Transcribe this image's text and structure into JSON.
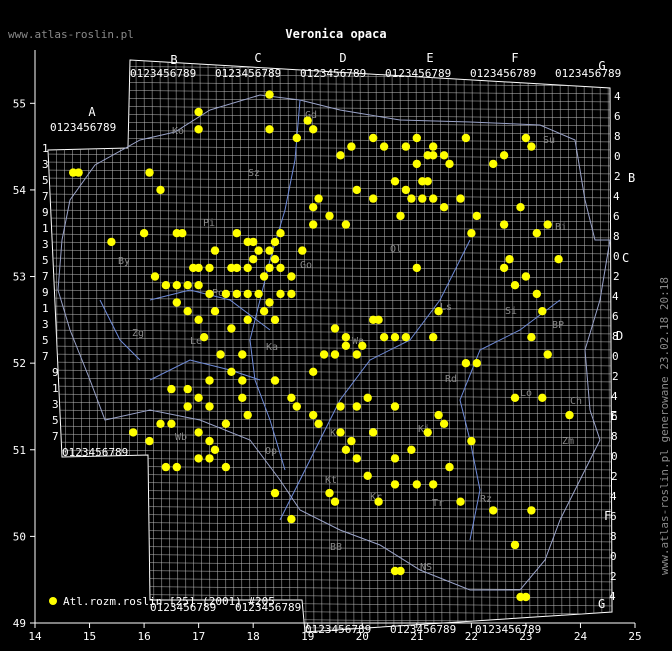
{
  "header": {
    "site": "www.atlas-roslin.pl",
    "title": "Veronica opaca"
  },
  "footer": {
    "side_text": "www.atlas-roslin.pl generowane 23.02.18 20:18"
  },
  "legend": {
    "label": "Atl.rozm.roslin [25] (2001) #205",
    "dot_color": "#ffff00"
  },
  "axes": {
    "x_ticks": [
      "14",
      "15",
      "16",
      "17",
      "18",
      "19",
      "20",
      "21",
      "22",
      "23",
      "24",
      "25"
    ],
    "y_ticks": [
      "55",
      "54",
      "53",
      "52",
      "51",
      "50",
      "49"
    ],
    "lon_range": [
      14,
      25
    ],
    "lat_range": [
      49,
      55.5
    ]
  },
  "grid": {
    "columns": [
      "A",
      "B",
      "C",
      "D",
      "E",
      "F",
      "G"
    ],
    "top_digits": "0123456789",
    "bottom_digits": "0123456789",
    "rows": [
      "A",
      "B",
      "C",
      "D",
      "E",
      "F",
      "G"
    ],
    "right_digits": [
      "0",
      "2",
      "4",
      "6",
      "8"
    ]
  },
  "regions": [
    "Ko",
    "Gd",
    "Sz",
    "Ol",
    "Su",
    "Bi",
    "Pi",
    "By",
    "Go",
    "Zg",
    "Le",
    "Po",
    "Ka",
    "Wa",
    "Si",
    "BP",
    "Lo",
    "Ch",
    "Zm",
    "Rd",
    "Kr",
    "Ki",
    "Tr",
    "Rz",
    "NS",
    "Kr",
    "Wb",
    "Op",
    "Kt",
    "BB",
    "Ls"
  ],
  "colors": {
    "background": "#000000",
    "grid": "#d8d8d8",
    "dot": "#ffff00",
    "rivers": "#6f8bd8",
    "border": "#9aa3c8",
    "axis": "#ffffff",
    "label_gray": "#8a8a8a"
  },
  "map_data": {
    "type": "distribution-map",
    "points": [
      [
        14.7,
        54.2
      ],
      [
        14.8,
        54.2
      ],
      [
        15.4,
        53.4
      ],
      [
        16.1,
        54.2
      ],
      [
        16.3,
        54.0
      ],
      [
        17.0,
        54.9
      ],
      [
        17.0,
        54.7
      ],
      [
        18.3,
        55.1
      ],
      [
        18.3,
        54.7
      ],
      [
        18.8,
        54.6
      ],
      [
        19.0,
        54.8
      ],
      [
        19.1,
        54.7
      ],
      [
        19.6,
        54.4
      ],
      [
        19.8,
        54.5
      ],
      [
        20.2,
        54.6
      ],
      [
        20.4,
        54.5
      ],
      [
        20.8,
        54.5
      ],
      [
        21.0,
        54.6
      ],
      [
        21.2,
        54.4
      ],
      [
        21.3,
        54.4
      ],
      [
        21.5,
        54.4
      ],
      [
        21.3,
        54.5
      ],
      [
        21.0,
        54.3
      ],
      [
        21.1,
        54.1
      ],
      [
        21.2,
        54.1
      ],
      [
        21.6,
        54.3
      ],
      [
        21.9,
        54.6
      ],
      [
        22.4,
        54.3
      ],
      [
        22.6,
        54.4
      ],
      [
        23.0,
        54.6
      ],
      [
        23.1,
        54.5
      ],
      [
        19.2,
        53.9
      ],
      [
        19.1,
        53.8
      ],
      [
        19.4,
        53.7
      ],
      [
        19.7,
        53.6
      ],
      [
        19.9,
        54.0
      ],
      [
        20.2,
        53.9
      ],
      [
        20.6,
        54.1
      ],
      [
        20.8,
        54.0
      ],
      [
        20.9,
        53.9
      ],
      [
        20.7,
        53.7
      ],
      [
        21.1,
        53.9
      ],
      [
        21.3,
        53.9
      ],
      [
        21.5,
        53.8
      ],
      [
        21.8,
        53.9
      ],
      [
        22.1,
        53.7
      ],
      [
        22.6,
        53.6
      ],
      [
        22.9,
        53.8
      ],
      [
        23.2,
        53.5
      ],
      [
        23.4,
        53.6
      ],
      [
        21.0,
        53.1
      ],
      [
        22.0,
        53.5
      ],
      [
        23.6,
        53.2
      ],
      [
        23.2,
        52.8
      ],
      [
        23.3,
        52.6
      ],
      [
        23.1,
        52.3
      ],
      [
        23.4,
        52.1
      ],
      [
        16.0,
        53.5
      ],
      [
        16.6,
        53.5
      ],
      [
        16.7,
        53.5
      ],
      [
        17.3,
        53.3
      ],
      [
        17.7,
        53.5
      ],
      [
        17.9,
        53.4
      ],
      [
        18.0,
        53.4
      ],
      [
        18.1,
        53.3
      ],
      [
        18.3,
        53.3
      ],
      [
        18.4,
        53.4
      ],
      [
        18.5,
        53.5
      ],
      [
        18.9,
        53.3
      ],
      [
        19.1,
        53.6
      ],
      [
        16.9,
        53.1
      ],
      [
        17.0,
        53.1
      ],
      [
        17.2,
        53.1
      ],
      [
        17.6,
        53.1
      ],
      [
        17.7,
        53.1
      ],
      [
        17.9,
        53.1
      ],
      [
        18.0,
        53.2
      ],
      [
        18.2,
        53.0
      ],
      [
        18.3,
        53.1
      ],
      [
        18.4,
        53.2
      ],
      [
        18.5,
        53.1
      ],
      [
        18.7,
        53.0
      ],
      [
        16.2,
        53.0
      ],
      [
        16.4,
        52.9
      ],
      [
        16.6,
        52.9
      ],
      [
        16.8,
        52.9
      ],
      [
        17.0,
        52.9
      ],
      [
        17.2,
        52.8
      ],
      [
        17.5,
        52.8
      ],
      [
        17.7,
        52.8
      ],
      [
        17.9,
        52.8
      ],
      [
        18.1,
        52.8
      ],
      [
        18.3,
        52.7
      ],
      [
        18.5,
        52.8
      ],
      [
        18.7,
        52.8
      ],
      [
        16.6,
        52.7
      ],
      [
        16.8,
        52.6
      ],
      [
        17.0,
        52.5
      ],
      [
        17.3,
        52.6
      ],
      [
        17.6,
        52.4
      ],
      [
        17.9,
        52.5
      ],
      [
        18.2,
        52.6
      ],
      [
        18.4,
        52.5
      ],
      [
        17.1,
        52.3
      ],
      [
        17.4,
        52.1
      ],
      [
        17.8,
        52.1
      ],
      [
        18.4,
        51.8
      ],
      [
        17.6,
        51.9
      ],
      [
        17.8,
        51.8
      ],
      [
        17.8,
        51.6
      ],
      [
        16.8,
        51.5
      ],
      [
        17.2,
        51.5
      ],
      [
        17.5,
        51.3
      ],
      [
        17.9,
        51.4
      ],
      [
        19.1,
        51.4
      ],
      [
        19.2,
        51.3
      ],
      [
        16.3,
        51.3
      ],
      [
        16.5,
        51.3
      ],
      [
        17.0,
        51.2
      ],
      [
        17.2,
        51.1
      ],
      [
        17.3,
        51.0
      ],
      [
        17.0,
        50.9
      ],
      [
        17.2,
        50.9
      ],
      [
        17.5,
        50.8
      ],
      [
        16.4,
        50.8
      ],
      [
        16.6,
        50.8
      ],
      [
        16.1,
        51.1
      ],
      [
        15.8,
        51.2
      ],
      [
        19.6,
        51.2
      ],
      [
        19.8,
        51.1
      ],
      [
        19.7,
        51.0
      ],
      [
        19.9,
        50.9
      ],
      [
        20.2,
        51.2
      ],
      [
        20.6,
        50.9
      ],
      [
        20.9,
        51.0
      ],
      [
        21.2,
        51.2
      ],
      [
        21.6,
        50.8
      ],
      [
        22.0,
        51.1
      ],
      [
        18.4,
        50.5
      ],
      [
        18.7,
        50.2
      ],
      [
        19.4,
        50.5
      ],
      [
        19.5,
        50.4
      ],
      [
        20.1,
        50.7
      ],
      [
        20.3,
        50.4
      ],
      [
        20.6,
        50.6
      ],
      [
        21.0,
        50.6
      ],
      [
        21.3,
        50.6
      ],
      [
        21.8,
        50.4
      ],
      [
        22.4,
        50.3
      ],
      [
        22.8,
        49.9
      ],
      [
        23.1,
        50.3
      ],
      [
        20.6,
        49.6
      ],
      [
        20.7,
        49.6
      ],
      [
        22.9,
        49.3
      ],
      [
        23.0,
        49.3
      ],
      [
        21.9,
        52.0
      ],
      [
        22.1,
        52.0
      ],
      [
        21.4,
        52.6
      ],
      [
        21.3,
        52.3
      ],
      [
        20.2,
        52.5
      ],
      [
        20.3,
        52.5
      ],
      [
        20.4,
        52.3
      ],
      [
        20.6,
        52.3
      ],
      [
        20.8,
        52.3
      ],
      [
        19.5,
        52.4
      ],
      [
        19.7,
        52.3
      ],
      [
        20.0,
        52.2
      ],
      [
        19.3,
        52.1
      ],
      [
        19.5,
        52.1
      ],
      [
        19.7,
        52.2
      ],
      [
        19.9,
        52.1
      ],
      [
        19.1,
        51.9
      ],
      [
        19.6,
        51.5
      ],
      [
        19.9,
        51.5
      ],
      [
        20.1,
        51.6
      ],
      [
        20.6,
        51.5
      ],
      [
        21.4,
        51.4
      ],
      [
        21.5,
        51.3
      ],
      [
        22.8,
        51.6
      ],
      [
        23.3,
        51.6
      ],
      [
        23.8,
        51.4
      ],
      [
        22.6,
        53.1
      ],
      [
        22.8,
        52.9
      ],
      [
        23.0,
        53.0
      ],
      [
        22.7,
        53.2
      ],
      [
        16.5,
        51.7
      ],
      [
        16.8,
        51.7
      ],
      [
        17.0,
        51.6
      ],
      [
        17.2,
        51.8
      ],
      [
        18.7,
        51.6
      ],
      [
        18.8,
        51.5
      ]
    ]
  }
}
